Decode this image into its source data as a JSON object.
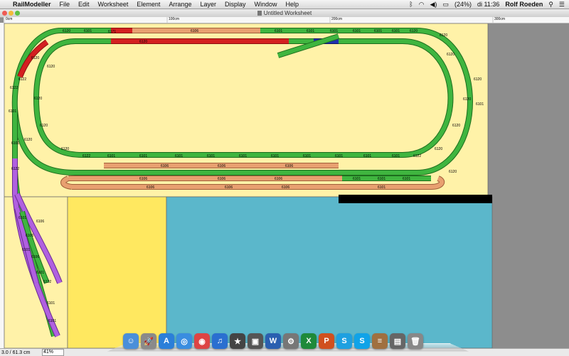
{
  "menubar": {
    "app_name": "RailModeller",
    "items": [
      "File",
      "Edit",
      "Worksheet",
      "Element",
      "Arrange",
      "Layer",
      "Display",
      "Window",
      "Help"
    ],
    "battery": "(24%)",
    "clock": "di 11:36",
    "user": "Rolf Roeden"
  },
  "window": {
    "title": "Untitled Worksheet"
  },
  "ruler": {
    "labels": [
      "0cm",
      "100cm",
      "200cm",
      "300cm"
    ]
  },
  "track_labels": {
    "top_left": [
      "6120",
      "6101",
      "6171",
      "6120",
      "6106",
      "6101",
      "6101",
      "6101",
      "6101",
      "6101",
      "6101",
      "6120"
    ],
    "right_curve": [
      "6120",
      "6120",
      "6120",
      "6120",
      "6101",
      "6120",
      "6120",
      "6120"
    ],
    "left_curve": [
      "6120",
      "6120",
      "6122",
      "6120",
      "6101",
      "6120",
      "6120",
      "6120",
      "6122"
    ],
    "bottom_row": [
      "6122",
      "6101",
      "6101",
      "6101",
      "6101",
      "6101",
      "6101",
      "6101",
      "6101",
      "6101",
      "6101",
      "6122"
    ],
    "siding_row1": [
      "6106",
      "6106",
      "6106"
    ],
    "siding_row2": [
      "6106",
      "6106",
      "6106",
      "6101",
      "6101",
      "6101"
    ],
    "siding_row3": [
      "6106",
      "6106",
      "6106",
      "6101"
    ],
    "purple_yard": [
      "6101",
      "6122",
      "6106",
      "6101",
      "6106",
      "6101",
      "6106",
      "6101",
      "6122",
      "6101",
      "6101"
    ]
  },
  "status": {
    "coords": "3.0 / 61.3 cm",
    "zoom": "41%"
  },
  "dock": {
    "items": [
      {
        "icon": "finder-icon",
        "color": "#4a8fd9",
        "glyph": "☺"
      },
      {
        "icon": "launchpad-icon",
        "color": "#8a8a8a",
        "glyph": "🚀"
      },
      {
        "icon": "app-store-icon",
        "color": "#2b7fd9",
        "glyph": "A"
      },
      {
        "icon": "safari-icon",
        "color": "#3a8de0",
        "glyph": "◎"
      },
      {
        "icon": "chrome-icon",
        "color": "#d44",
        "glyph": "◉"
      },
      {
        "icon": "itunes-icon",
        "color": "#2a6fd0",
        "glyph": "♫"
      },
      {
        "icon": "imovie-icon",
        "color": "#444",
        "glyph": "★"
      },
      {
        "icon": "iphoto-icon",
        "color": "#555",
        "glyph": "▣"
      },
      {
        "icon": "word-icon",
        "color": "#2a5fb0",
        "glyph": "W"
      },
      {
        "icon": "preferences-icon",
        "color": "#777",
        "glyph": "⚙"
      },
      {
        "icon": "excel-icon",
        "color": "#1e8a3a",
        "glyph": "X"
      },
      {
        "icon": "powerpoint-icon",
        "color": "#d0501e",
        "glyph": "P"
      },
      {
        "icon": "skype-express-icon",
        "color": "#1ea0e0",
        "glyph": "S"
      },
      {
        "icon": "skype-icon",
        "color": "#10a3e8",
        "glyph": "S"
      },
      {
        "icon": "railmodeller-icon",
        "color": "#a07040",
        "glyph": "≡"
      },
      {
        "icon": "documents-icon",
        "color": "#666",
        "glyph": "▤"
      },
      {
        "icon": "trash-icon",
        "color": "#888",
        "glyph": "🗑"
      }
    ]
  },
  "colors": {
    "board_main": "#fff2a8",
    "board_left": "#fff2a8",
    "board_mid": "#ffe860",
    "board_teal": "#5bb7cb",
    "track_green": "#3fb53f",
    "track_red": "#d42020",
    "track_tan": "#e8a070",
    "track_purple": "#b060e0",
    "track_blue": "#2030b0"
  }
}
